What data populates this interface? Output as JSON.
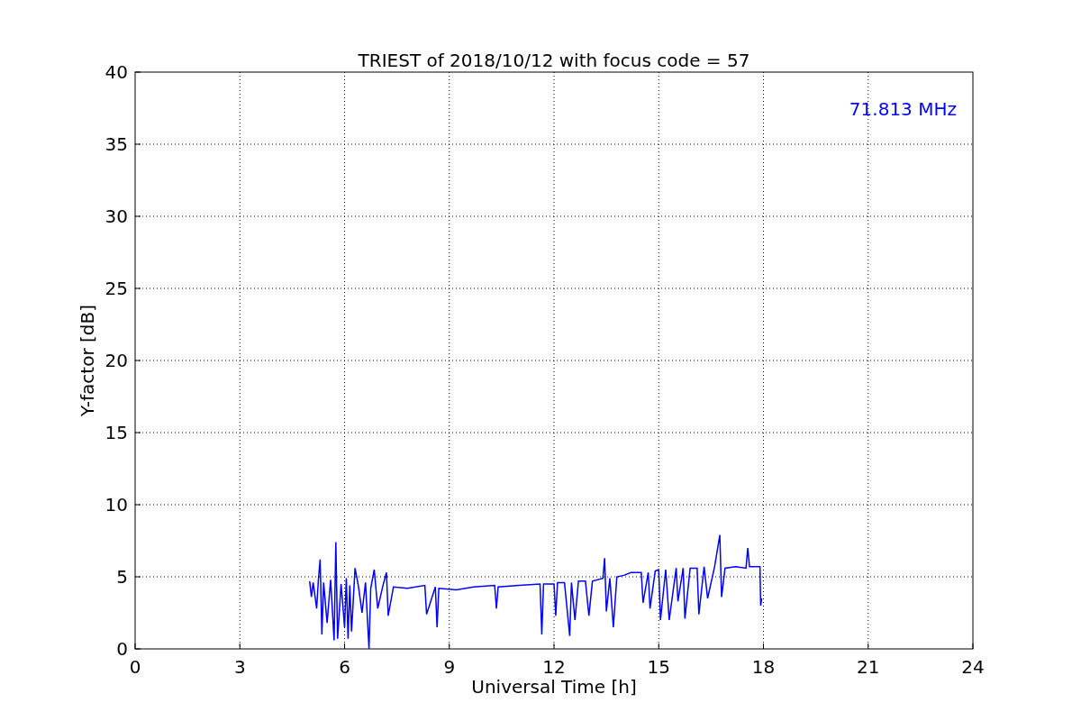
{
  "figure": {
    "chart_data": {
      "type": "line",
      "title": "TRIEST of 2018/10/12 with focus code = 57",
      "xlabel": "Universal Time [h]",
      "ylabel": "Y-factor [dB]",
      "x": [
        5.0,
        5.05,
        5.1,
        5.2,
        5.25,
        5.3,
        5.35,
        5.4,
        5.5,
        5.6,
        5.7,
        5.75,
        5.8,
        5.9,
        6.0,
        6.05,
        6.1,
        6.15,
        6.2,
        6.3,
        6.4,
        6.5,
        6.6,
        6.7,
        6.75,
        6.85,
        6.95,
        7.1,
        7.2,
        7.25,
        7.4,
        7.8,
        8.3,
        8.35,
        8.6,
        8.65,
        8.7,
        9.2,
        9.7,
        10.3,
        10.35,
        10.4,
        11.0,
        11.6,
        11.65,
        11.7,
        12.0,
        12.05,
        12.1,
        12.3,
        12.45,
        12.5,
        12.6,
        12.7,
        12.9,
        13.0,
        13.1,
        13.4,
        13.45,
        13.5,
        13.6,
        13.7,
        13.8,
        14.0,
        14.2,
        14.5,
        14.55,
        14.7,
        14.75,
        14.9,
        15.0,
        15.05,
        15.2,
        15.3,
        15.5,
        15.55,
        15.7,
        15.75,
        15.9,
        16.1,
        16.15,
        16.3,
        16.4,
        16.6,
        16.75,
        16.8,
        16.9,
        17.2,
        17.5,
        17.55,
        17.6,
        17.9,
        17.92,
        17.95
      ],
      "series": [
        {
          "color": "#0000ff",
          "values": [
            4.7,
            3.6,
            4.6,
            2.8,
            4.8,
            6.2,
            1.0,
            4.6,
            1.8,
            4.8,
            0.6,
            7.4,
            0.7,
            4.5,
            1.5,
            4.9,
            0.7,
            4.4,
            1.2,
            5.6,
            4.3,
            2.5,
            4.6,
            0.0,
            4.2,
            5.5,
            2.8,
            4.4,
            5.3,
            2.3,
            4.3,
            4.2,
            4.4,
            2.4,
            4.3,
            1.5,
            4.2,
            4.1,
            4.3,
            4.4,
            2.8,
            4.3,
            4.4,
            4.5,
            1.0,
            4.5,
            4.5,
            2.3,
            4.6,
            4.6,
            0.9,
            4.6,
            2.0,
            4.7,
            4.7,
            2.3,
            4.7,
            4.9,
            6.3,
            2.6,
            4.9,
            1.5,
            5.0,
            5.1,
            5.3,
            5.3,
            3.2,
            5.3,
            2.8,
            5.4,
            5.5,
            2.0,
            5.5,
            2.0,
            5.6,
            3.3,
            5.6,
            2.1,
            5.6,
            5.6,
            2.4,
            5.7,
            3.5,
            5.7,
            7.9,
            3.6,
            5.6,
            5.7,
            5.6,
            7.0,
            5.7,
            5.7,
            3.0,
            3.5
          ]
        }
      ],
      "xlim": [
        0,
        24
      ],
      "ylim": [
        0,
        40
      ],
      "xticks": [
        0,
        3,
        6,
        9,
        12,
        15,
        18,
        21,
        24
      ],
      "yticks": [
        0,
        5,
        10,
        15,
        20,
        25,
        30,
        35,
        40
      ],
      "grid": true,
      "annotations": [
        {
          "text": "71.813 MHz"
        }
      ]
    }
  }
}
